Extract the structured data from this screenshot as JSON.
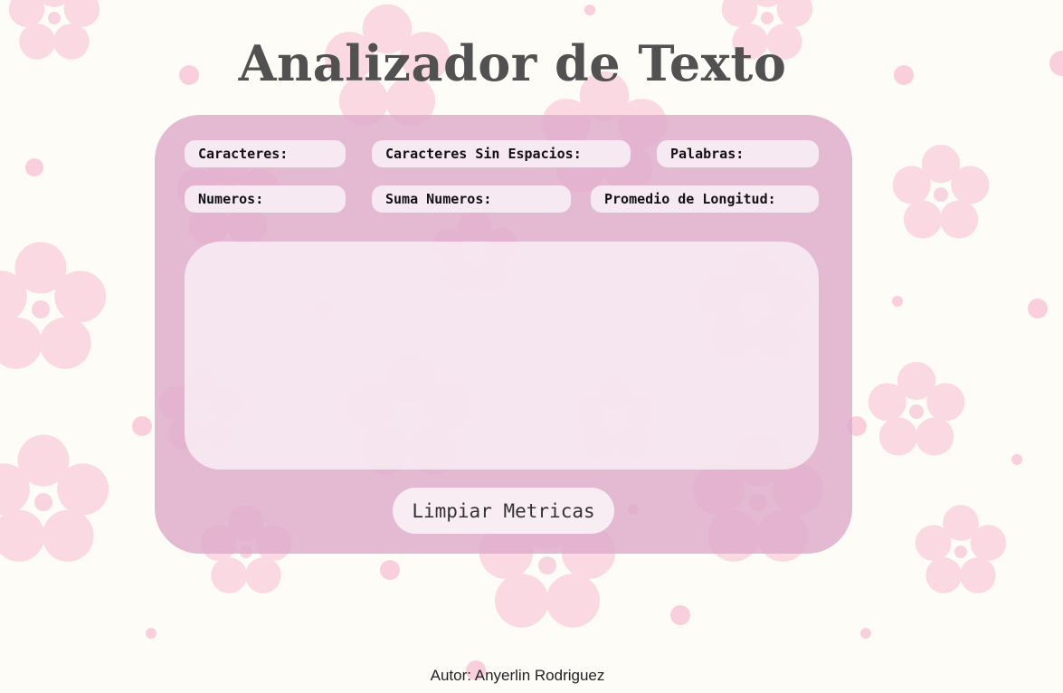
{
  "page": {
    "title": "Analizador de Texto",
    "footer": "Autor: Anyerlin Rodriguez"
  },
  "metrics": {
    "caracteres": "Caracteres:",
    "caracteres_sin_espacios": "Caracteres Sin Espacios:",
    "palabras": "Palabras:",
    "numeros": "Numeros:",
    "suma_numeros": " Suma Numeros:",
    "promedio_longitud": "Promedio de Longitud:"
  },
  "editor": {
    "value": "",
    "placeholder": ""
  },
  "actions": {
    "clear_label": "Limpiar Metricas"
  },
  "colors": {
    "background": "#fefcf7",
    "card": "#deabcb",
    "panel": "#faeef6",
    "title": "#515151",
    "blossom": "#f5a3c4"
  },
  "decoration": {
    "background_pattern": "cherry-blossom-flowers"
  }
}
